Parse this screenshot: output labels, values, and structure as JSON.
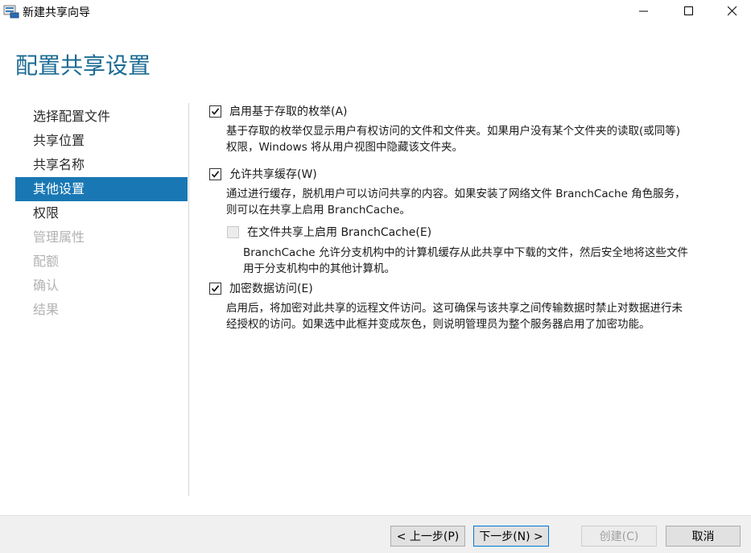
{
  "window": {
    "title": "新建共享向导"
  },
  "page": {
    "title": "配置共享设置"
  },
  "nav": {
    "items": [
      {
        "label": "选择配置文件",
        "state": "normal"
      },
      {
        "label": "共享位置",
        "state": "normal"
      },
      {
        "label": "共享名称",
        "state": "normal"
      },
      {
        "label": "其他设置",
        "state": "active"
      },
      {
        "label": "权限",
        "state": "normal"
      },
      {
        "label": "管理属性",
        "state": "disabled"
      },
      {
        "label": "配额",
        "state": "disabled"
      },
      {
        "label": "确认",
        "state": "disabled"
      },
      {
        "label": "结果",
        "state": "disabled"
      }
    ]
  },
  "options": {
    "abe": {
      "label": "启用基于存取的枚举(A)",
      "checked": true,
      "desc1": "基于存取的枚举仅显示用户有权访问的文件和文件夹。如果用户没有某个文件夹的读取(或同等)",
      "desc2": "权限，Windows 将从用户视图中隐藏该文件夹。"
    },
    "cache": {
      "label": "允许共享缓存(W)",
      "checked": true,
      "desc1": "通过进行缓存，脱机用户可以访问共享的内容。如果安装了网络文件 BranchCache 角色服务，",
      "desc2": "则可以在共享上启用 BranchCache。"
    },
    "branchcache": {
      "label": "在文件共享上启用 BranchCache(E)",
      "checked": false,
      "enabled": false,
      "desc1": "BranchCache 允许分支机构中的计算机缓存从此共享中下载的文件，然后安全地将这些文件",
      "desc2": "用于分支机构中的其他计算机。"
    },
    "encrypt": {
      "label": "加密数据访问(E)",
      "checked": true,
      "desc1": "启用后，将加密对此共享的远程文件访问。这可确保与该共享之间传输数据时禁止对数据进行未",
      "desc2": "经授权的访问。如果选中此框并变成灰色，则说明管理员为整个服务器启用了加密功能。"
    }
  },
  "footer": {
    "prev": "< 上一步(P)",
    "next": "下一步(N) >",
    "create": "创建(C)",
    "cancel": "取消"
  },
  "colors": {
    "accent": "#1978b4",
    "title": "#1b6b93"
  }
}
